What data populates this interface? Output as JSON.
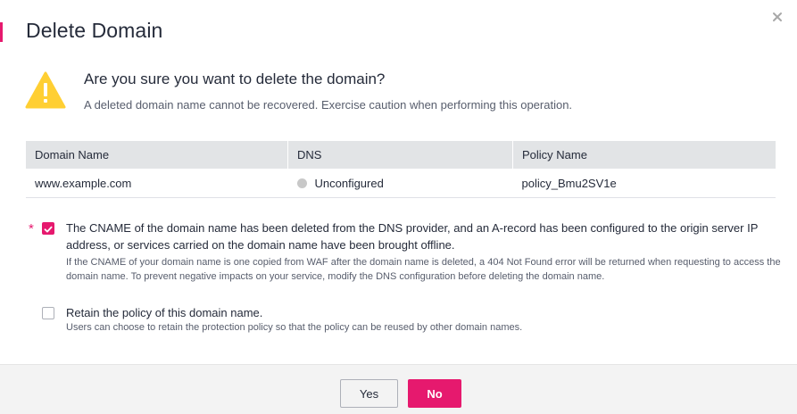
{
  "dialog": {
    "title": "Delete Domain",
    "accent_color": "#e6196e"
  },
  "warning": {
    "icon": "warning-triangle-icon",
    "question": "Are you sure you want to delete the domain?",
    "description": "A deleted domain name cannot be recovered. Exercise caution when performing this operation."
  },
  "table": {
    "headers": [
      "Domain Name",
      "DNS",
      "Policy Name"
    ],
    "rows": [
      {
        "domain_name": "www.example.com",
        "dns_status": "Unconfigured",
        "policy_name": "policy_Bmu2SV1e"
      }
    ]
  },
  "confirm": {
    "required_mark": "*",
    "checked": true,
    "label": "The CNAME of the domain name has been deleted from the DNS provider, and an A-record has been configured to the origin server IP address, or services carried on the domain name have been brought offline.",
    "note": "If the CNAME of your domain name is one copied from WAF after the domain name is deleted, a 404 Not Found error will be returned when requesting to access the domain name. To prevent negative impacts on your service, modify the DNS configuration before deleting the domain name."
  },
  "retain": {
    "checked": false,
    "label": "Retain the policy of this domain name.",
    "note": "Users can choose to retain the protection policy so that the policy can be reused by other domain names."
  },
  "footer": {
    "yes_label": "Yes",
    "no_label": "No"
  }
}
